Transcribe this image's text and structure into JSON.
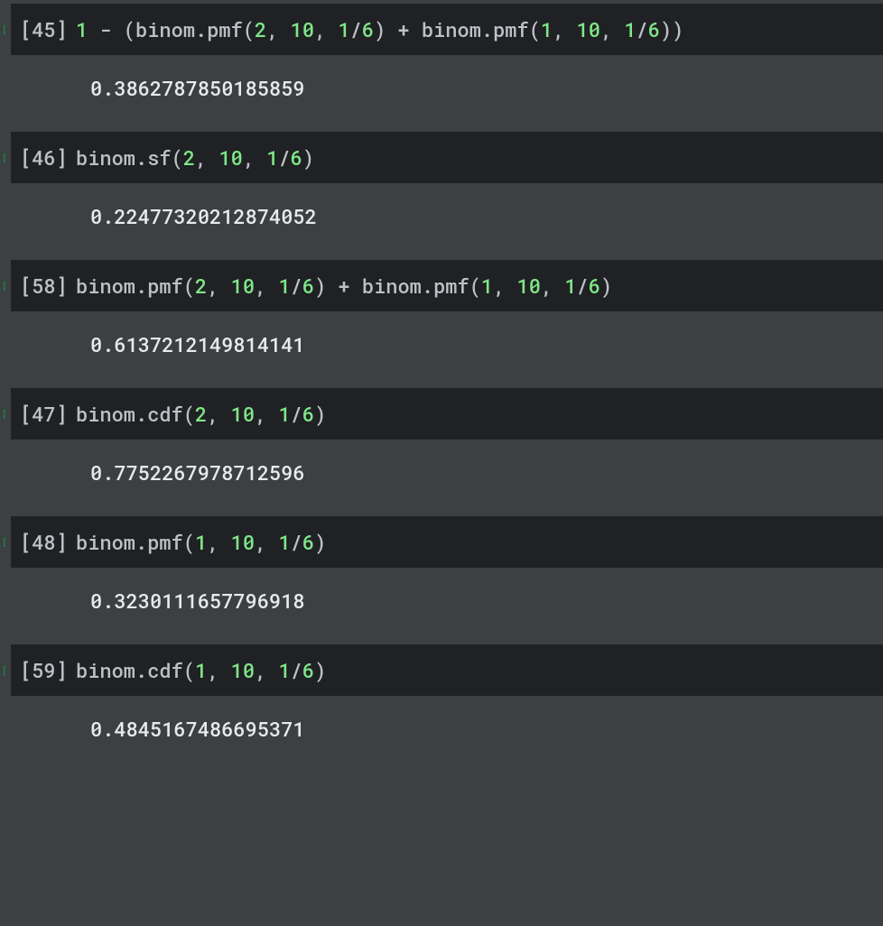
{
  "cells": [
    {
      "exec": "[45]",
      "tokens": [
        {
          "t": "1",
          "c": "num"
        },
        {
          "t": " - (binom.pmf(",
          "c": "fn"
        },
        {
          "t": "2",
          "c": "num"
        },
        {
          "t": ", ",
          "c": "op"
        },
        {
          "t": "10",
          "c": "num"
        },
        {
          "t": ", ",
          "c": "op"
        },
        {
          "t": "1",
          "c": "num"
        },
        {
          "t": "/",
          "c": "op"
        },
        {
          "t": "6",
          "c": "num"
        },
        {
          "t": ") + binom.pmf(",
          "c": "fn"
        },
        {
          "t": "1",
          "c": "num"
        },
        {
          "t": ", ",
          "c": "op"
        },
        {
          "t": "10",
          "c": "num"
        },
        {
          "t": ", ",
          "c": "op"
        },
        {
          "t": "1",
          "c": "num"
        },
        {
          "t": "/",
          "c": "op"
        },
        {
          "t": "6",
          "c": "num"
        },
        {
          "t": "))",
          "c": "fn"
        }
      ],
      "output": "0.3862787850185859"
    },
    {
      "exec": "[46]",
      "tokens": [
        {
          "t": "binom.sf(",
          "c": "fn"
        },
        {
          "t": "2",
          "c": "num"
        },
        {
          "t": ", ",
          "c": "op"
        },
        {
          "t": "10",
          "c": "num"
        },
        {
          "t": ", ",
          "c": "op"
        },
        {
          "t": "1",
          "c": "num"
        },
        {
          "t": "/",
          "c": "op"
        },
        {
          "t": "6",
          "c": "num"
        },
        {
          "t": ")",
          "c": "fn"
        }
      ],
      "output": "0.22477320212874052"
    },
    {
      "exec": "[58]",
      "tokens": [
        {
          "t": "binom.pmf(",
          "c": "fn"
        },
        {
          "t": "2",
          "c": "num"
        },
        {
          "t": ", ",
          "c": "op"
        },
        {
          "t": "10",
          "c": "num"
        },
        {
          "t": ", ",
          "c": "op"
        },
        {
          "t": "1",
          "c": "num"
        },
        {
          "t": "/",
          "c": "op"
        },
        {
          "t": "6",
          "c": "num"
        },
        {
          "t": ") + binom.pmf(",
          "c": "fn"
        },
        {
          "t": "1",
          "c": "num"
        },
        {
          "t": ", ",
          "c": "op"
        },
        {
          "t": "10",
          "c": "num"
        },
        {
          "t": ", ",
          "c": "op"
        },
        {
          "t": "1",
          "c": "num"
        },
        {
          "t": "/",
          "c": "op"
        },
        {
          "t": "6",
          "c": "num"
        },
        {
          "t": ")",
          "c": "fn"
        }
      ],
      "output": "0.6137212149814141"
    },
    {
      "exec": "[47]",
      "tokens": [
        {
          "t": "binom.cdf(",
          "c": "fn"
        },
        {
          "t": "2",
          "c": "num"
        },
        {
          "t": ", ",
          "c": "op"
        },
        {
          "t": "10",
          "c": "num"
        },
        {
          "t": ", ",
          "c": "op"
        },
        {
          "t": "1",
          "c": "num"
        },
        {
          "t": "/",
          "c": "op"
        },
        {
          "t": "6",
          "c": "num"
        },
        {
          "t": ")",
          "c": "fn"
        }
      ],
      "output": "0.7752267978712596"
    },
    {
      "exec": "[48]",
      "tokens": [
        {
          "t": "binom.pmf(",
          "c": "fn"
        },
        {
          "t": "1",
          "c": "num"
        },
        {
          "t": ", ",
          "c": "op"
        },
        {
          "t": "10",
          "c": "num"
        },
        {
          "t": ", ",
          "c": "op"
        },
        {
          "t": "1",
          "c": "num"
        },
        {
          "t": "/",
          "c": "op"
        },
        {
          "t": "6",
          "c": "num"
        },
        {
          "t": ")",
          "c": "fn"
        }
      ],
      "output": "0.3230111657796918"
    },
    {
      "exec": "[59]",
      "tokens": [
        {
          "t": "binom.cdf(",
          "c": "fn"
        },
        {
          "t": "1",
          "c": "num"
        },
        {
          "t": ", ",
          "c": "op"
        },
        {
          "t": "10",
          "c": "num"
        },
        {
          "t": ", ",
          "c": "op"
        },
        {
          "t": "1",
          "c": "num"
        },
        {
          "t": "/",
          "c": "op"
        },
        {
          "t": "6",
          "c": "num"
        },
        {
          "t": ")",
          "c": "fn"
        }
      ],
      "output": "0.4845167486695371"
    }
  ]
}
